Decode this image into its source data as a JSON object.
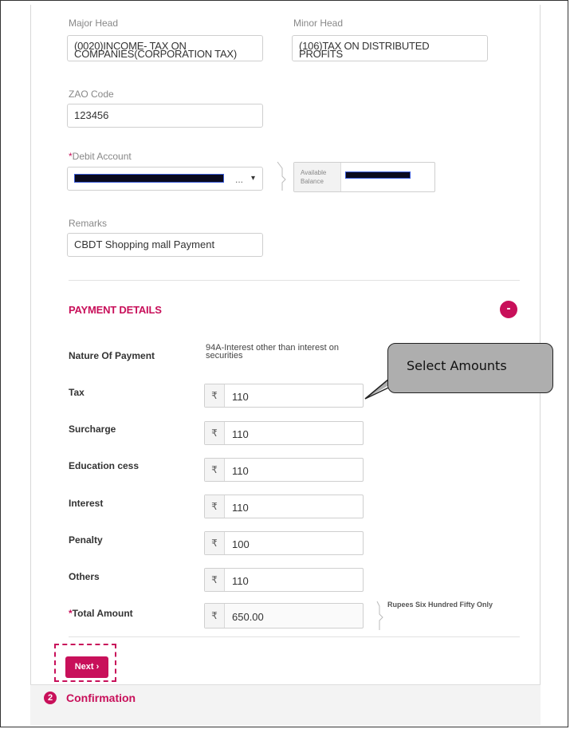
{
  "form": {
    "major_head": {
      "label": "Major Head",
      "line1": "(0020)INCOME- TAX ON",
      "line2": "COMPANIES(CORPORATION TAX)"
    },
    "minor_head": {
      "label": "Minor Head",
      "line1": "(106)TAX ON DISTRIBUTED",
      "line2": "PROFITS"
    },
    "zao_code": {
      "label": "ZAO Code",
      "value": "123456"
    },
    "debit_account": {
      "required_mark": "*",
      "label": "Debit Account",
      "ellipsis": "...",
      "caret": "▾"
    },
    "available_balance": {
      "line1": "Available",
      "line2": "Balance"
    },
    "remarks": {
      "label": "Remarks",
      "value": "CBDT Shopping mall Payment"
    }
  },
  "payment_details": {
    "title": "PAYMENT DETAILS",
    "collapse_glyph": "-",
    "nature_label": "Nature Of Payment",
    "nature_line1": "94A-Interest other than interest on",
    "nature_line2": "securities",
    "currency_symbol": "₹",
    "rows": [
      {
        "label": "Tax",
        "value": "110"
      },
      {
        "label": "Surcharge",
        "value": "110"
      },
      {
        "label": "Education cess",
        "value": "110"
      },
      {
        "label": "Interest",
        "value": "110"
      },
      {
        "label": "Penalty",
        "value": "100"
      },
      {
        "label": "Others",
        "value": "110"
      }
    ],
    "total": {
      "required_mark": "*",
      "label": "Total Amount",
      "value": "650.00",
      "words": "Rupees Six Hundred Fifty Only"
    }
  },
  "callout": {
    "text": "Select Amounts"
  },
  "actions": {
    "next_label": "Next ›"
  },
  "confirmation": {
    "step": "2",
    "label": "Confirmation"
  },
  "colors": {
    "accent": "#c8105a",
    "callout_fill": "#aeaeae"
  }
}
